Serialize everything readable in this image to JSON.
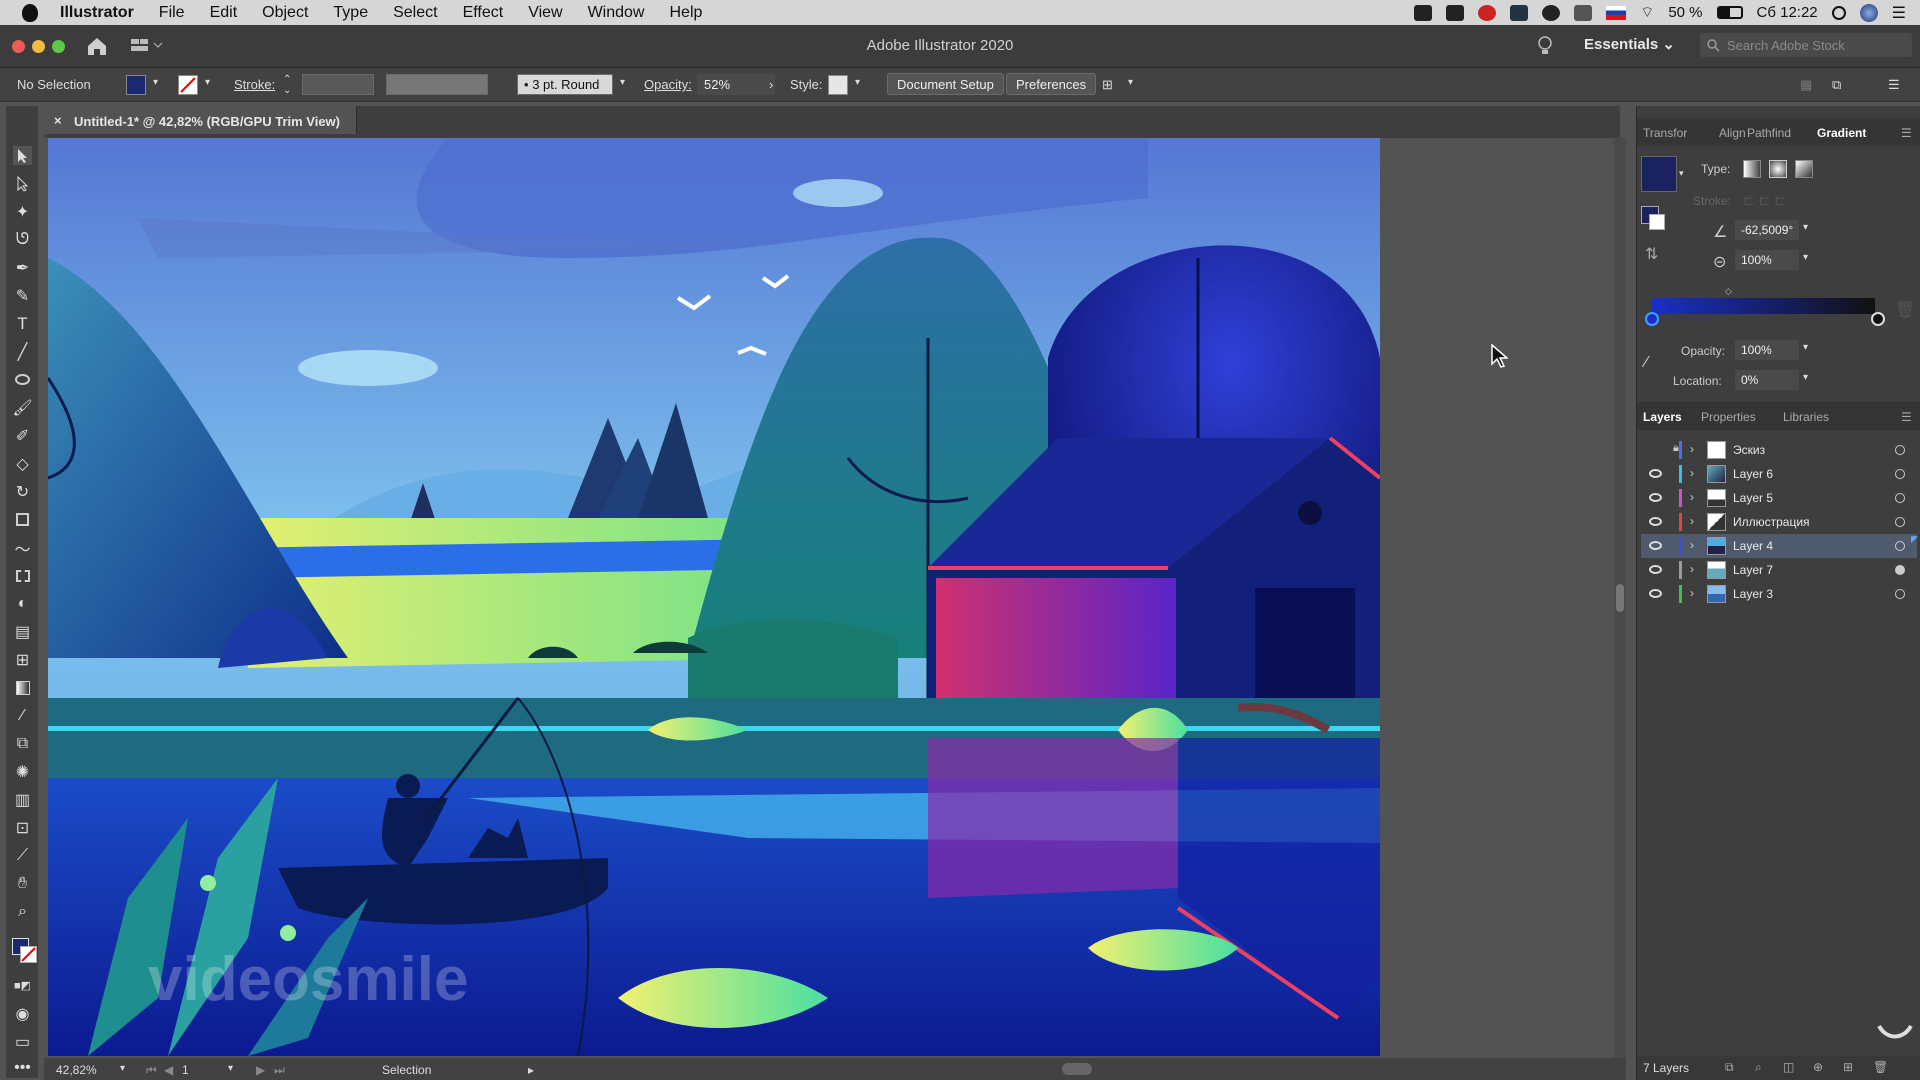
{
  "menubar": {
    "app": "Illustrator",
    "items": [
      "File",
      "Edit",
      "Object",
      "Type",
      "Select",
      "Effect",
      "View",
      "Window",
      "Help"
    ],
    "battery": "50 %",
    "clock": "Сб 12:22"
  },
  "titlebar": {
    "title": "Adobe Illustrator 2020",
    "workspace": "Essentials",
    "search_placeholder": "Search Adobe Stock"
  },
  "control": {
    "selection": "No Selection",
    "stroke_label": "Stroke:",
    "brush": "3 pt. Round",
    "opacity_label": "Opacity:",
    "opacity": "52%",
    "style_label": "Style:",
    "document_setup": "Document Setup",
    "preferences": "Preferences",
    "fill_color": "#1b2a6e"
  },
  "document": {
    "tab": "Untitled-1* @ 42,82% (RGB/GPU Trim View)"
  },
  "status": {
    "zoom": "42,82%",
    "artboard": "1",
    "tool": "Selection"
  },
  "gradient_panel": {
    "tabs": [
      "Transfor",
      "Align",
      "Pathfind",
      "Gradient"
    ],
    "type_label": "Type:",
    "stroke_label": "Stroke:",
    "angle": "-62,5009°",
    "aspect": "100%",
    "opacity_label": "Opacity:",
    "opacity": "100%",
    "location_label": "Location:",
    "location": "0%",
    "start_color": "#1a2fc9",
    "end_color": "#111111"
  },
  "layers_panel": {
    "tabs": [
      "Layers",
      "Properties",
      "Libraries"
    ],
    "count": "7 Layers",
    "layers": [
      {
        "name": "Эскиз",
        "color": "#4d6cf0",
        "visible": false,
        "locked": true
      },
      {
        "name": "Layer 6",
        "color": "#3fb8f0",
        "visible": true
      },
      {
        "name": "Layer 5",
        "color": "#d050d0",
        "visible": true
      },
      {
        "name": "Иллюстрация",
        "color": "#e04545",
        "visible": true
      },
      {
        "name": "Layer 4",
        "color": "#3a4fe0",
        "visible": true,
        "selected": true
      },
      {
        "name": "Layer 7",
        "color": "#9a9a9a",
        "visible": true
      },
      {
        "name": "Layer 3",
        "color": "#3fc050",
        "visible": true
      }
    ]
  },
  "watermark": "videosmile"
}
